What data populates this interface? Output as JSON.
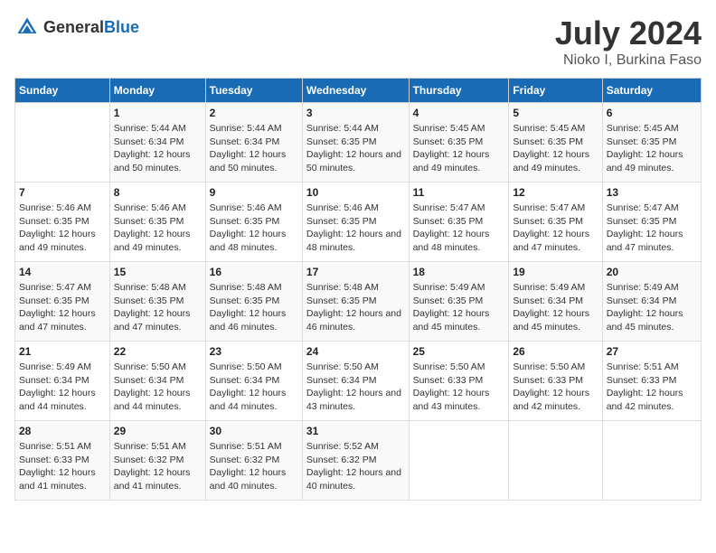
{
  "header": {
    "logo_general": "General",
    "logo_blue": "Blue",
    "month_year": "July 2024",
    "location": "Nioko I, Burkina Faso"
  },
  "columns": [
    "Sunday",
    "Monday",
    "Tuesday",
    "Wednesday",
    "Thursday",
    "Friday",
    "Saturday"
  ],
  "weeks": [
    [
      {
        "day": "",
        "sunrise": "",
        "sunset": "",
        "daylight": ""
      },
      {
        "day": "1",
        "sunrise": "Sunrise: 5:44 AM",
        "sunset": "Sunset: 6:34 PM",
        "daylight": "Daylight: 12 hours and 50 minutes."
      },
      {
        "day": "2",
        "sunrise": "Sunrise: 5:44 AM",
        "sunset": "Sunset: 6:34 PM",
        "daylight": "Daylight: 12 hours and 50 minutes."
      },
      {
        "day": "3",
        "sunrise": "Sunrise: 5:44 AM",
        "sunset": "Sunset: 6:35 PM",
        "daylight": "Daylight: 12 hours and 50 minutes."
      },
      {
        "day": "4",
        "sunrise": "Sunrise: 5:45 AM",
        "sunset": "Sunset: 6:35 PM",
        "daylight": "Daylight: 12 hours and 49 minutes."
      },
      {
        "day": "5",
        "sunrise": "Sunrise: 5:45 AM",
        "sunset": "Sunset: 6:35 PM",
        "daylight": "Daylight: 12 hours and 49 minutes."
      },
      {
        "day": "6",
        "sunrise": "Sunrise: 5:45 AM",
        "sunset": "Sunset: 6:35 PM",
        "daylight": "Daylight: 12 hours and 49 minutes."
      }
    ],
    [
      {
        "day": "7",
        "sunrise": "Sunrise: 5:46 AM",
        "sunset": "Sunset: 6:35 PM",
        "daylight": "Daylight: 12 hours and 49 minutes."
      },
      {
        "day": "8",
        "sunrise": "Sunrise: 5:46 AM",
        "sunset": "Sunset: 6:35 PM",
        "daylight": "Daylight: 12 hours and 49 minutes."
      },
      {
        "day": "9",
        "sunrise": "Sunrise: 5:46 AM",
        "sunset": "Sunset: 6:35 PM",
        "daylight": "Daylight: 12 hours and 48 minutes."
      },
      {
        "day": "10",
        "sunrise": "Sunrise: 5:46 AM",
        "sunset": "Sunset: 6:35 PM",
        "daylight": "Daylight: 12 hours and 48 minutes."
      },
      {
        "day": "11",
        "sunrise": "Sunrise: 5:47 AM",
        "sunset": "Sunset: 6:35 PM",
        "daylight": "Daylight: 12 hours and 48 minutes."
      },
      {
        "day": "12",
        "sunrise": "Sunrise: 5:47 AM",
        "sunset": "Sunset: 6:35 PM",
        "daylight": "Daylight: 12 hours and 47 minutes."
      },
      {
        "day": "13",
        "sunrise": "Sunrise: 5:47 AM",
        "sunset": "Sunset: 6:35 PM",
        "daylight": "Daylight: 12 hours and 47 minutes."
      }
    ],
    [
      {
        "day": "14",
        "sunrise": "Sunrise: 5:47 AM",
        "sunset": "Sunset: 6:35 PM",
        "daylight": "Daylight: 12 hours and 47 minutes."
      },
      {
        "day": "15",
        "sunrise": "Sunrise: 5:48 AM",
        "sunset": "Sunset: 6:35 PM",
        "daylight": "Daylight: 12 hours and 47 minutes."
      },
      {
        "day": "16",
        "sunrise": "Sunrise: 5:48 AM",
        "sunset": "Sunset: 6:35 PM",
        "daylight": "Daylight: 12 hours and 46 minutes."
      },
      {
        "day": "17",
        "sunrise": "Sunrise: 5:48 AM",
        "sunset": "Sunset: 6:35 PM",
        "daylight": "Daylight: 12 hours and 46 minutes."
      },
      {
        "day": "18",
        "sunrise": "Sunrise: 5:49 AM",
        "sunset": "Sunset: 6:35 PM",
        "daylight": "Daylight: 12 hours and 45 minutes."
      },
      {
        "day": "19",
        "sunrise": "Sunrise: 5:49 AM",
        "sunset": "Sunset: 6:34 PM",
        "daylight": "Daylight: 12 hours and 45 minutes."
      },
      {
        "day": "20",
        "sunrise": "Sunrise: 5:49 AM",
        "sunset": "Sunset: 6:34 PM",
        "daylight": "Daylight: 12 hours and 45 minutes."
      }
    ],
    [
      {
        "day": "21",
        "sunrise": "Sunrise: 5:49 AM",
        "sunset": "Sunset: 6:34 PM",
        "daylight": "Daylight: 12 hours and 44 minutes."
      },
      {
        "day": "22",
        "sunrise": "Sunrise: 5:50 AM",
        "sunset": "Sunset: 6:34 PM",
        "daylight": "Daylight: 12 hours and 44 minutes."
      },
      {
        "day": "23",
        "sunrise": "Sunrise: 5:50 AM",
        "sunset": "Sunset: 6:34 PM",
        "daylight": "Daylight: 12 hours and 44 minutes."
      },
      {
        "day": "24",
        "sunrise": "Sunrise: 5:50 AM",
        "sunset": "Sunset: 6:34 PM",
        "daylight": "Daylight: 12 hours and 43 minutes."
      },
      {
        "day": "25",
        "sunrise": "Sunrise: 5:50 AM",
        "sunset": "Sunset: 6:33 PM",
        "daylight": "Daylight: 12 hours and 43 minutes."
      },
      {
        "day": "26",
        "sunrise": "Sunrise: 5:50 AM",
        "sunset": "Sunset: 6:33 PM",
        "daylight": "Daylight: 12 hours and 42 minutes."
      },
      {
        "day": "27",
        "sunrise": "Sunrise: 5:51 AM",
        "sunset": "Sunset: 6:33 PM",
        "daylight": "Daylight: 12 hours and 42 minutes."
      }
    ],
    [
      {
        "day": "28",
        "sunrise": "Sunrise: 5:51 AM",
        "sunset": "Sunset: 6:33 PM",
        "daylight": "Daylight: 12 hours and 41 minutes."
      },
      {
        "day": "29",
        "sunrise": "Sunrise: 5:51 AM",
        "sunset": "Sunset: 6:32 PM",
        "daylight": "Daylight: 12 hours and 41 minutes."
      },
      {
        "day": "30",
        "sunrise": "Sunrise: 5:51 AM",
        "sunset": "Sunset: 6:32 PM",
        "daylight": "Daylight: 12 hours and 40 minutes."
      },
      {
        "day": "31",
        "sunrise": "Sunrise: 5:52 AM",
        "sunset": "Sunset: 6:32 PM",
        "daylight": "Daylight: 12 hours and 40 minutes."
      },
      {
        "day": "",
        "sunrise": "",
        "sunset": "",
        "daylight": ""
      },
      {
        "day": "",
        "sunrise": "",
        "sunset": "",
        "daylight": ""
      },
      {
        "day": "",
        "sunrise": "",
        "sunset": "",
        "daylight": ""
      }
    ]
  ]
}
